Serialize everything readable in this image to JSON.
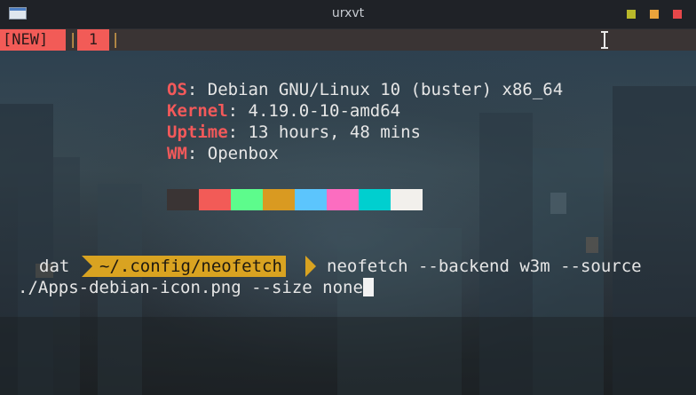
{
  "window": {
    "title": "urxvt",
    "app_icon": "terminal-window-icon",
    "buttons": {
      "minimize_color": "#b9b82a",
      "maximize_color": "#e9a33b",
      "close_color": "#e6474a"
    }
  },
  "tabs": {
    "items": [
      {
        "label": "[NEW]"
      },
      {
        "label": "1"
      }
    ],
    "separator": "|",
    "tab_color": "#f25b57",
    "separator_color": "#d9a34b"
  },
  "neofetch": {
    "lines": [
      {
        "key": "OS",
        "value": " Debian GNU/Linux 10 (buster) x86_64"
      },
      {
        "key": "Kernel",
        "value": " 4.19.0-10-amd64"
      },
      {
        "key": "Uptime",
        "value": " 13 hours, 48 mins"
      },
      {
        "key": "WM",
        "value": " Openbox"
      }
    ],
    "key_color": "#f3595a",
    "separator": ":",
    "palette": [
      "#3a3434",
      "#f25b57",
      "#5dfc8c",
      "#d99a21",
      "#5cc5fd",
      "#fc6dc0",
      "#00cfcf",
      "#f2f0ec"
    ]
  },
  "prompt": {
    "user": "dat",
    "path": "~/.config/neofetch",
    "path_color": "#d9a321",
    "command_line_1": "neofetch --backend w3m --source",
    "command_line_2": "./Apps-debian-icon.png --size none"
  }
}
